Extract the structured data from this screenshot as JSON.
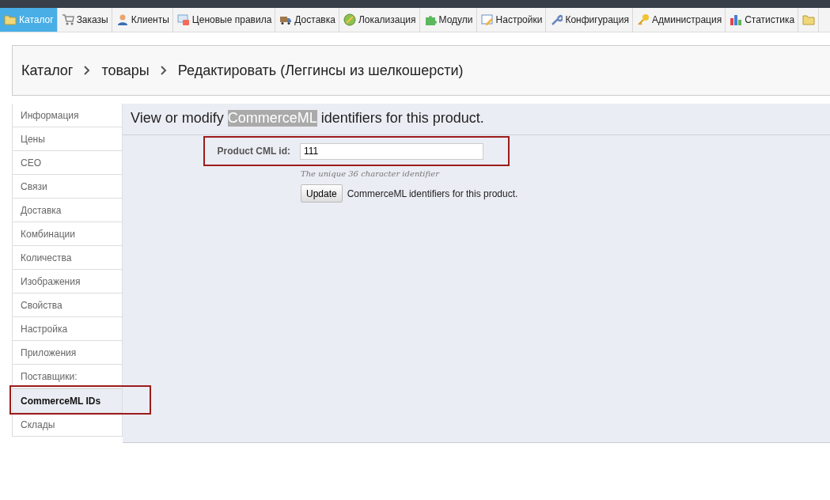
{
  "top_tabs": [
    {
      "label": "Каталог",
      "selected": true
    },
    {
      "label": "Заказы",
      "selected": false
    },
    {
      "label": "Клиенты",
      "selected": false
    },
    {
      "label": "Ценовые правила",
      "selected": false
    },
    {
      "label": "Доставка",
      "selected": false
    },
    {
      "label": "Локализация",
      "selected": false
    },
    {
      "label": "Модули",
      "selected": false
    },
    {
      "label": "Настройки",
      "selected": false
    },
    {
      "label": "Конфигурация",
      "selected": false
    },
    {
      "label": "Администрация",
      "selected": false
    },
    {
      "label": "Статистика",
      "selected": false
    },
    {
      "selected": false
    }
  ],
  "breadcrumb": [
    "Каталог",
    "товары",
    "Редактировать (Леггинсы из шелкошерсти)"
  ],
  "sidebar": {
    "items": [
      {
        "label": "Информация",
        "selected": false
      },
      {
        "label": "Цены",
        "selected": false
      },
      {
        "label": "СЕО",
        "selected": false
      },
      {
        "label": "Связи",
        "selected": false
      },
      {
        "label": "Доставка",
        "selected": false
      },
      {
        "label": "Комбинации",
        "selected": false
      },
      {
        "label": "Количества",
        "selected": false
      },
      {
        "label": "Изображения",
        "selected": false
      },
      {
        "label": "Свойства",
        "selected": false
      },
      {
        "label": "Настройка",
        "selected": false
      },
      {
        "label": "Приложения",
        "selected": false
      },
      {
        "label": "Поставщики:",
        "selected": false
      },
      {
        "label": "CommerceML IDs",
        "selected": true
      },
      {
        "label": "Склады",
        "selected": false
      }
    ]
  },
  "content": {
    "heading": {
      "before": "View or modify",
      "highlight": "CommerceML",
      "after": "identifiers for this product."
    },
    "field": {
      "label": "Product CML id:",
      "value": "111",
      "hint": "The unique 36 character identifier",
      "highlighted": true
    },
    "button": "Update",
    "button_note": "CommerceML identifiers for this product."
  }
}
